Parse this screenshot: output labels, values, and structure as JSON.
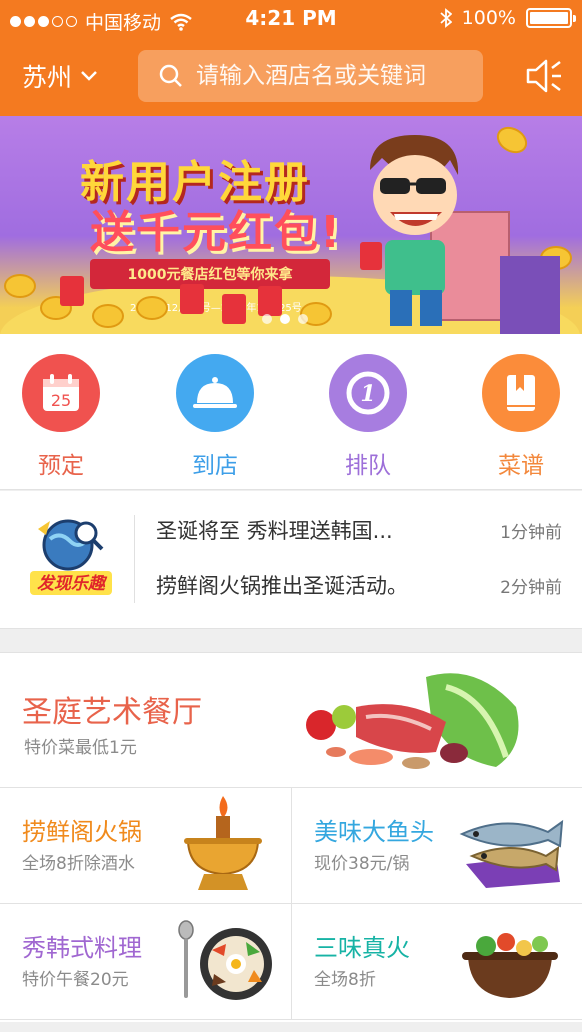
{
  "status_bar": {
    "carrier": "中国移动",
    "time": "4:21 PM",
    "battery": "100%"
  },
  "header": {
    "city": "苏州",
    "search_placeholder": "请输入酒店名或关键词"
  },
  "banner": {
    "title_line1": "新用户注册",
    "title_line2": "送千元红包!",
    "ribbon_text": "1000元餐店红包等你来拿",
    "date_range": "2015年12月12号—2015年12月25号"
  },
  "quick_actions": [
    {
      "label": "预定",
      "icon": "calendar-icon",
      "color": "#f0524f",
      "text_color": "#e8634b",
      "badge": "25"
    },
    {
      "label": "到店",
      "icon": "cloche-icon",
      "color": "#44a9f0",
      "text_color": "#3e9fe8"
    },
    {
      "label": "排队",
      "icon": "queue-number-icon",
      "color": "#a77de0",
      "text_color": "#9d6fd9",
      "badge": "1"
    },
    {
      "label": "菜谱",
      "icon": "book-icon",
      "color": "#fb8c3a",
      "text_color": "#f3883c"
    }
  ],
  "news": {
    "logo_text": "发现乐趣",
    "items": [
      {
        "title": "圣诞将至  秀料理送韩国...",
        "time": "1分钟前"
      },
      {
        "title": "捞鲜阁火锅推出圣诞活动。",
        "time": "2分钟前"
      }
    ]
  },
  "featured": {
    "name": "圣庭艺术餐厅",
    "subtitle": "特价菜最低1元"
  },
  "restaurants": [
    {
      "name": "捞鲜阁火锅",
      "subtitle": "全场8折除酒水",
      "color": "#f08a1c"
    },
    {
      "name": "美味大鱼头",
      "subtitle": "现价38元/锅",
      "color": "#34a7df"
    },
    {
      "name": "秀韩式料理",
      "subtitle": "特价午餐20元",
      "color": "#a067d1"
    },
    {
      "name": "三味真火",
      "subtitle": "全场8折",
      "color": "#17b3a5"
    }
  ]
}
